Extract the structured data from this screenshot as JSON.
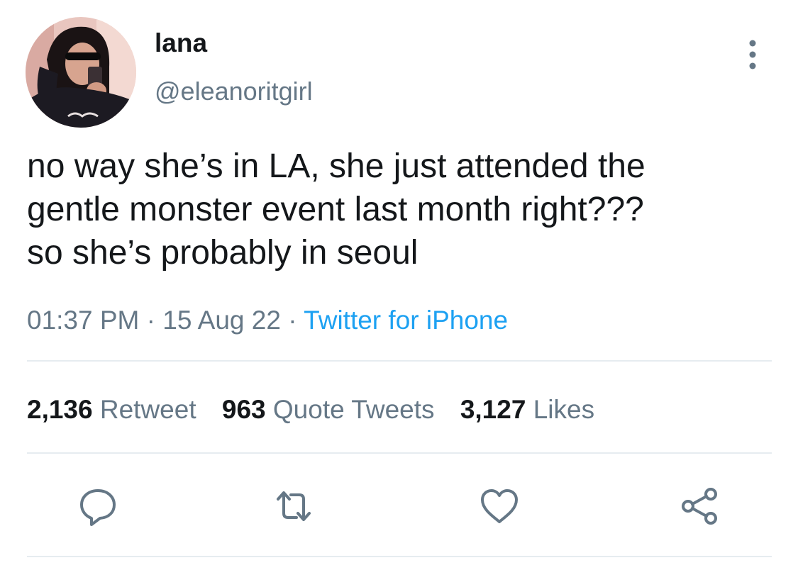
{
  "user": {
    "display_name": "lana",
    "handle": "@eleanoritgirl"
  },
  "tweet": {
    "lines": [
      "no way she’s in LA, she just attended the",
      "gentle monster event last month right???",
      "so she’s probably in seoul"
    ],
    "time": "01:37 PM",
    "separator": "·",
    "date": "15 Aug 22",
    "source": "Twitter for iPhone"
  },
  "stats": {
    "retweets_count": "2,136",
    "retweets_label": "Retweet",
    "quotes_count": "963",
    "quotes_label": "Quote Tweets",
    "likes_count": "3,127",
    "likes_label": "Likes"
  },
  "icons": {
    "more": "more-vertical-icon",
    "reply": "reply-icon",
    "retweet": "retweet-icon",
    "like": "heart-icon",
    "share": "share-icon"
  },
  "colors": {
    "text": "#14171a",
    "secondary": "#657786",
    "link": "#1da1f2",
    "divider": "#e6ecf0"
  }
}
